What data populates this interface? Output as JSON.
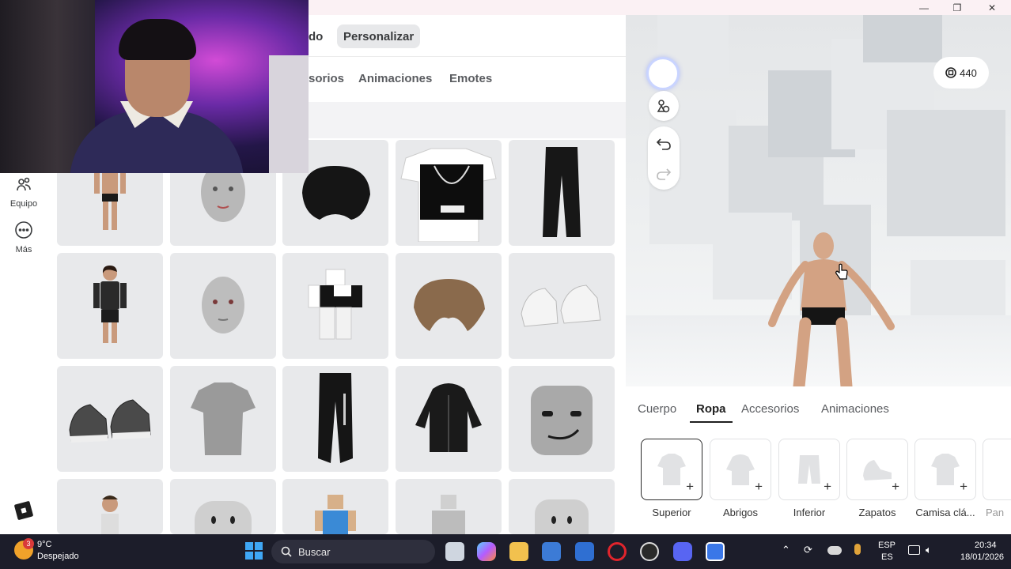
{
  "window": {
    "minimize": "—",
    "restore": "❐",
    "close": "✕"
  },
  "header": {
    "tabs": [
      {
        "label": "do"
      },
      {
        "label": "Personalizar"
      }
    ]
  },
  "category_tabs": [
    {
      "label": "sorios"
    },
    {
      "label": "Animaciones"
    },
    {
      "label": "Emotes"
    }
  ],
  "sidebar": {
    "items": [
      {
        "label": "Equipo",
        "icon": "outfit-icon"
      },
      {
        "label": "Más",
        "icon": "more-icon"
      }
    ],
    "logo": "roblox-logo"
  },
  "grid": {
    "rows": [
      [
        "avatar-figure",
        "head-face",
        "black-hair",
        "necklace-tshirt",
        "black-pants"
      ],
      [
        "avatar-dark-outfit",
        "bald-head",
        "blocky-shirt-avatar",
        "brown-hair",
        "white-sneakers"
      ],
      [
        "gray-sneakers",
        "gray-tshirt",
        "black-joggers",
        "black-hoodie",
        "smirk-face"
      ],
      [
        "avatar-small",
        "round-head",
        "blocky-avatar-blue",
        "gray-blocky-avatar",
        "gray-cylinder-head"
      ]
    ]
  },
  "preview": {
    "robux": "440"
  },
  "panel": {
    "tabs": [
      {
        "label": "Cuerpo",
        "active": false
      },
      {
        "label": "Ropa",
        "active": true
      },
      {
        "label": "Accesorios",
        "active": false
      },
      {
        "label": "Animaciones",
        "active": false
      }
    ],
    "slots": [
      {
        "label": "Superior",
        "selected": true
      },
      {
        "label": "Abrigos",
        "selected": false
      },
      {
        "label": "Inferior",
        "selected": false
      },
      {
        "label": "Zapatos",
        "selected": false
      },
      {
        "label": "Camisa clá...",
        "selected": false
      },
      {
        "label": "Pan",
        "selected": false
      }
    ]
  },
  "taskbar": {
    "weather": {
      "badge": "3",
      "temp": "9°C",
      "desc": "Despejado"
    },
    "search_placeholder": "Buscar",
    "lang": {
      "line1": "ESP",
      "line2": "ES"
    },
    "time": "20:34",
    "date": "18/01/2026"
  }
}
